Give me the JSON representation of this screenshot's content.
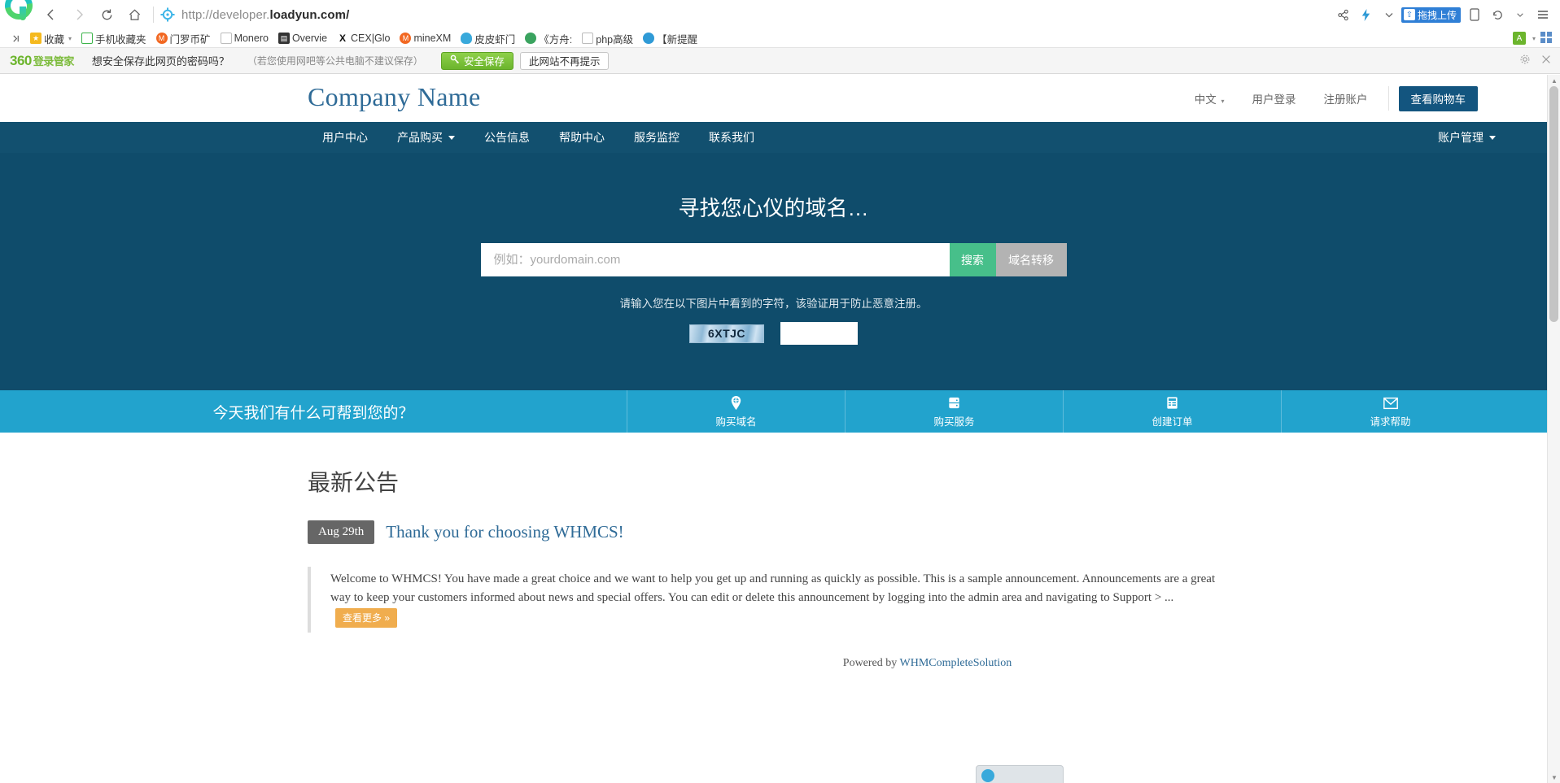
{
  "browser": {
    "url_display": "http://developer.",
    "url_domain": "loadyun.com/",
    "back_icon": "back-arrow-icon",
    "forward_icon": "forward-arrow-icon",
    "reload_icon": "reload-icon",
    "home_icon": "home-icon",
    "upload_chip_label": "拖拽上传",
    "bookmarks": [
      {
        "label": "收藏",
        "icon": "star-icon",
        "color": "#f5b91e",
        "caret": true
      },
      {
        "label": "手机收藏夹",
        "icon": "phone-icon",
        "color": "#3cb44a"
      },
      {
        "label": "门罗币矿",
        "icon": "monero-icon",
        "color": "#f26822"
      },
      {
        "label": "Monero",
        "icon": "page-icon",
        "color": "#ffffff"
      },
      {
        "label": "Overvie",
        "icon": "chart-icon",
        "color": "#333333"
      },
      {
        "label": "CEX|Glo",
        "icon": "x-icon",
        "color": "#111111"
      },
      {
        "label": "mineXM",
        "icon": "monero-icon",
        "color": "#f26822"
      },
      {
        "label": "皮皮虾门",
        "icon": "shrimp-icon",
        "color": "#39a9db"
      },
      {
        "label": "《方舟:",
        "icon": "globe-icon",
        "color": "#3aa35f"
      },
      {
        "label": "php高级",
        "icon": "page-icon",
        "color": "#ffffff"
      },
      {
        "label": "【新提醒",
        "icon": "eye-icon",
        "color": "#2f9ad6"
      }
    ]
  },
  "password_bar": {
    "logo": "360",
    "logo_sub": "登录管家",
    "question": "想安全保存此网页的密码吗？",
    "note": "（若您使用网吧等公共电脑不建议保存）",
    "save_label": "安全保存",
    "never_label": "此网站不再提示",
    "gear_icon": "gear-icon",
    "close_icon": "close-icon"
  },
  "site": {
    "brand": "Company Name",
    "header_links": [
      {
        "label": "中文",
        "caret": true
      },
      {
        "label": "用户登录",
        "caret": false
      },
      {
        "label": "注册账户",
        "caret": false
      }
    ],
    "cart_label": "查看购物车",
    "nav": [
      {
        "label": "用户中心",
        "caret": false
      },
      {
        "label": "产品购买",
        "caret": true
      },
      {
        "label": "公告信息",
        "caret": false
      },
      {
        "label": "帮助中心",
        "caret": false
      },
      {
        "label": "服务监控",
        "caret": false
      },
      {
        "label": "联系我们",
        "caret": false
      }
    ],
    "nav_right": {
      "label": "账户管理",
      "caret": true
    }
  },
  "hero": {
    "title": "寻找您心仪的域名…",
    "search_placeholder": "例如：yourdomain.com",
    "search_value": "",
    "search_button": "搜索",
    "transfer_button": "域名转移",
    "captcha_note": "请输入您在以下图片中看到的字符，该验证用于防止恶意注册。",
    "captcha_text": "6XTJC",
    "captcha_input_value": "",
    "bg_color": "#0f4c6b",
    "search_btn_color": "#47bf8a",
    "transfer_btn_color": "#b3b3b3"
  },
  "action_bar": {
    "title": "今天我们有什么可帮到您的？",
    "bg_color": "#22a3cd",
    "items": [
      {
        "label": "购买域名",
        "icon": "globe-pin-icon"
      },
      {
        "label": "购买服务",
        "icon": "server-icon"
      },
      {
        "label": "创建订单",
        "icon": "invoice-icon"
      },
      {
        "label": "请求帮助",
        "icon": "envelope-icon"
      }
    ]
  },
  "announcements": {
    "heading": "最新公告",
    "items": [
      {
        "date": "Aug 29th",
        "title": "Thank you for choosing WHMCS!",
        "body": "Welcome to WHMCS! You have made a great choice and we want to help you get up and running as quickly as possible. This is a sample announcement. Announcements are a great way to keep your customers informed about news and special offers. You can edit or delete this announcement by logging into the admin area and navigating to Support > ...",
        "more_label": "查看更多 »"
      }
    ]
  },
  "footer": {
    "prefix": "Powered by",
    "link": "WHMCompleteSolution"
  }
}
